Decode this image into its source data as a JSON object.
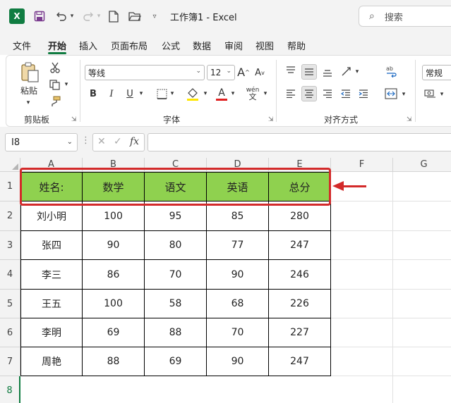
{
  "titlebar": {
    "title": "工作簿1  -  Excel",
    "search_label": "搜索"
  },
  "menu": {
    "tabs": [
      "文件",
      "开始",
      "插入",
      "页面布局",
      "公式",
      "数据",
      "审阅",
      "视图",
      "帮助"
    ],
    "active_index": 1
  },
  "ribbon": {
    "clipboard": {
      "paste_label": "粘贴",
      "group_label": "剪贴板"
    },
    "font": {
      "font_name": "等线",
      "font_size": "12",
      "group_label": "字体",
      "bold": "B",
      "italic": "I",
      "underline": "U",
      "grow": "A",
      "shrink": "A",
      "font_color": "A",
      "phonetic": "wén"
    },
    "alignment": {
      "group_label": "对齐方式"
    },
    "number": {
      "format": "常规"
    }
  },
  "formula_bar": {
    "name_box": "I8",
    "fx": "fx",
    "content": ""
  },
  "sheet": {
    "columns": [
      "A",
      "B",
      "C",
      "D",
      "E",
      "F",
      "G"
    ],
    "rows": [
      "1",
      "2",
      "3",
      "4",
      "5",
      "6",
      "7",
      "8"
    ],
    "header": [
      "姓名:",
      "数学",
      "语文",
      "英语",
      "总分"
    ],
    "data": [
      [
        "刘小明",
        "100",
        "95",
        "85",
        "280"
      ],
      [
        "张四",
        "90",
        "80",
        "77",
        "247"
      ],
      [
        "李三",
        "86",
        "70",
        "90",
        "246"
      ],
      [
        "王五",
        "100",
        "58",
        "68",
        "226"
      ],
      [
        "李明",
        "69",
        "88",
        "70",
        "227"
      ],
      [
        "周艳",
        "88",
        "69",
        "90",
        "247"
      ]
    ]
  },
  "colors": {
    "header_fill": "#8fd14f",
    "annotation_red": "#d32a2a",
    "excel_green": "#107c41"
  },
  "icons": {
    "app": "excel-icon",
    "save": "save-icon",
    "undo": "undo-icon",
    "redo": "redo-icon",
    "new": "new-file-icon",
    "open": "open-folder-icon",
    "search": "search-icon"
  }
}
